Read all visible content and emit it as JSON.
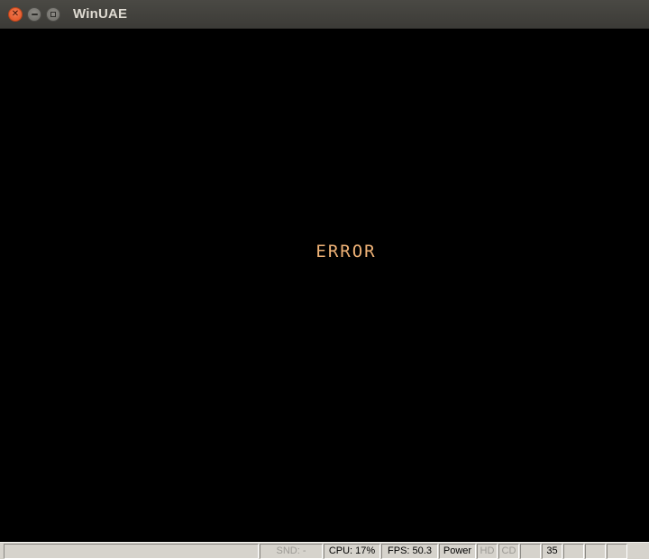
{
  "window": {
    "title": "WinUAE",
    "buttons": {
      "close_glyph": "✕"
    }
  },
  "screen": {
    "message": "ERROR",
    "background_color": "#000000",
    "text_color": "#f0b377"
  },
  "statusbar": {
    "message": "",
    "snd": "SND: -",
    "cpu": "CPU: 17%",
    "fps": "FPS: 50.3",
    "power": "Power",
    "hd": "HD",
    "cd": "CD",
    "drive0": "",
    "drive1": "35",
    "drive2": "",
    "drive3": "",
    "drive4": ""
  }
}
